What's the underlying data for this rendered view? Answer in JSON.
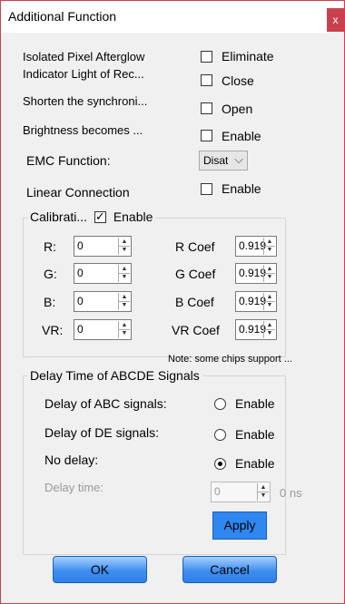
{
  "window": {
    "title": "Additional Function",
    "close_glyph": "x"
  },
  "settings": [
    {
      "label": "Isolated Pixel Afterglow",
      "option": "Eliminate"
    },
    {
      "label": "Indicator Light of Rec...",
      "option": "Close"
    },
    {
      "label": "Shorten the synchroni...",
      "option": "Open"
    },
    {
      "label": "Brightness becomes ...",
      "option": "Enable"
    }
  ],
  "emc": {
    "label": "EMC Function:",
    "value": "Disat"
  },
  "linear": {
    "label": "Linear Connection",
    "option": "Enable"
  },
  "calibration": {
    "title": "Calibrati...",
    "enable_label": "Enable",
    "rows": [
      {
        "label": "R:",
        "value": "0",
        "coef_label": "R Coef",
        "coef": "0.919"
      },
      {
        "label": "G:",
        "value": "0",
        "coef_label": "G Coef",
        "coef": "0.919"
      },
      {
        "label": "B:",
        "value": "0",
        "coef_label": "B Coef",
        "coef": "0.919"
      },
      {
        "label": "VR:",
        "value": "0",
        "coef_label": "VR Coef",
        "coef": "0.919"
      }
    ]
  },
  "note": "Note: some chips support ...",
  "delay": {
    "title": "Delay Time of ABCDE Signals",
    "rows": [
      {
        "label": "Delay of ABC signals:",
        "option": "Enable"
      },
      {
        "label": "Delay of DE signals:",
        "option": "Enable"
      },
      {
        "label": "No delay:",
        "option": "Enable"
      }
    ],
    "time_label": "Delay time:",
    "time_value": "0",
    "unit": "0 ns",
    "apply": "Apply"
  },
  "buttons": {
    "ok": "OK",
    "cancel": "Cancel"
  }
}
